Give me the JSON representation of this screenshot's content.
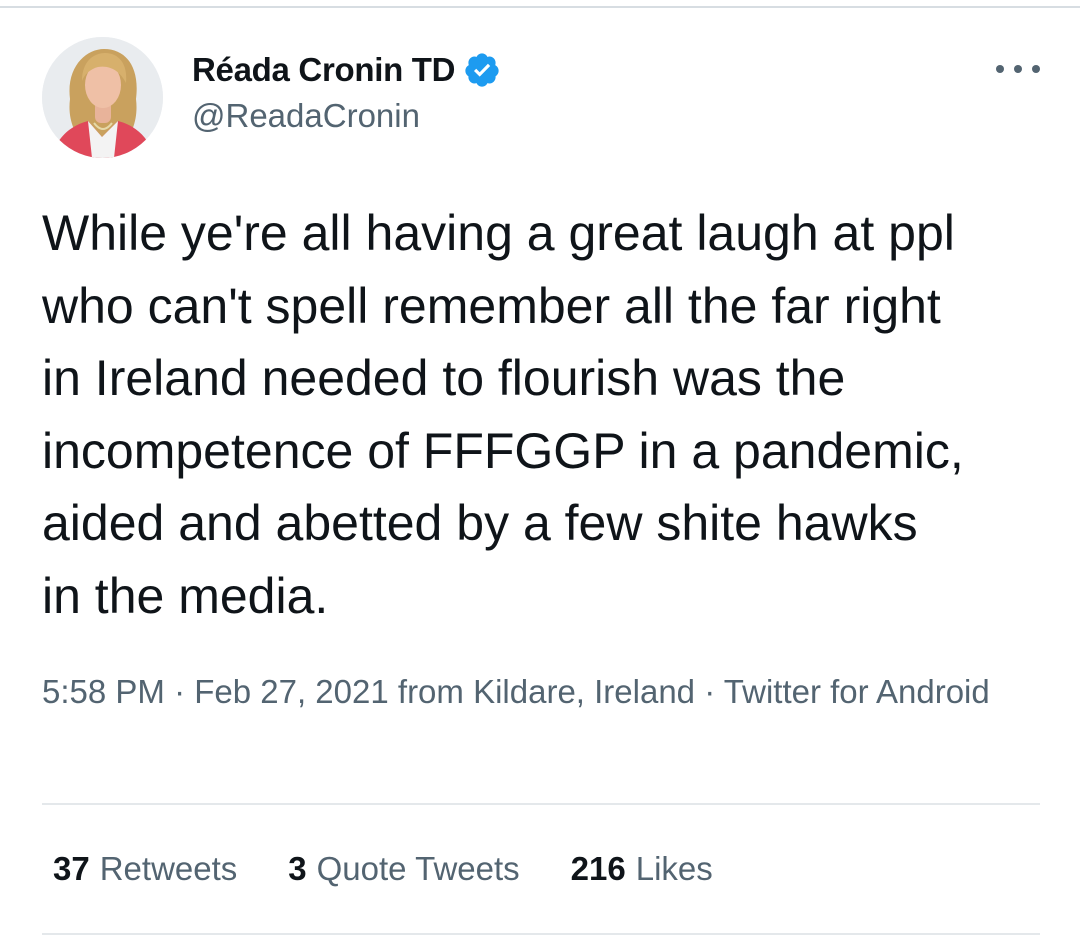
{
  "author": {
    "display_name": "Réada Cronin TD",
    "handle": "@ReadaCronin",
    "verified": true
  },
  "icons": {
    "verified": "verified-badge-icon",
    "more": "more-options-icon"
  },
  "tweet": {
    "text": "While ye're all having a great laugh at ppl\nwho can't spell remember all the far right\nin Ireland needed to flourish was the\nincompetence of FFFGGP in a pandemic,\naided and abetted by a few shite hawks\nin the media."
  },
  "meta": {
    "time": "5:58 PM",
    "sep1": " · ",
    "date": "Feb 27, 2021",
    "location": " from Kildare, Ireland",
    "sep2": " · ",
    "source": "Twitter for Android"
  },
  "stats": {
    "retweets": {
      "count": "37",
      "label": "Retweets"
    },
    "quotes": {
      "count": "3",
      "label": "Quote Tweets"
    },
    "likes": {
      "count": "216",
      "label": "Likes"
    }
  },
  "colors": {
    "text": "#0f1419",
    "secondary": "#536471",
    "verified": "#1d9bf0",
    "divider": "#e4e8eb"
  }
}
